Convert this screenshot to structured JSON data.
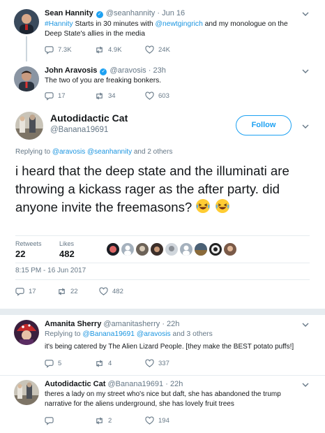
{
  "tweets": {
    "hannity": {
      "name": "Sean Hannity",
      "handle": "@seanhannity",
      "dot": "·",
      "time": "Jun 16",
      "text_parts": [
        "#Hannity",
        " Starts in 30 minutes with ",
        "@newtgingrich",
        " and my monologue on the Deep State's allies in the media"
      ],
      "replies": "7.3K",
      "retweets": "4.9K",
      "likes": "24K"
    },
    "aravosis": {
      "name": "John Aravosis",
      "handle": "@aravosis",
      "dot": "·",
      "time": "23h",
      "text": "The two of you are freaking bonkers.",
      "replies": "17",
      "retweets": "34",
      "likes": "603"
    },
    "main": {
      "name": "Autodidactic Cat",
      "handle": "@Banana19691",
      "follow_label": "Follow",
      "replying_prefix": "Replying to ",
      "replying_user1": "@aravosis",
      "replying_user2": "@seanhannity",
      "replying_suffix": " and 2 others",
      "text": "i heard that the deep state and the illuminati are throwing a kickass rager as the after party. did anyone invite the freemasons?",
      "retweets_label": "Retweets",
      "retweets": "22",
      "likes_label": "Likes",
      "likes": "482",
      "timestamp": "8:15 PM - 16 Jun 2017",
      "replies_count": "17",
      "retweets_count": "22",
      "likes_count": "482"
    },
    "amanita": {
      "name": "Amanita Sherry",
      "handle": "@amanitasherry",
      "dot": "·",
      "time": "22h",
      "replying_prefix": "Replying to ",
      "replying_user1": "@Banana19691",
      "replying_user2": "@aravosis",
      "replying_suffix": " and 3 others",
      "text": "it's being catered by The Alien Lizard People. [they make the BEST potato puffs!]",
      "replies": "5",
      "retweets": "4",
      "likes": "337"
    },
    "cat_reply": {
      "name": "Autodidactic Cat",
      "handle": "@Banana19691",
      "dot": "·",
      "time": "22h",
      "text": "theres a lady on my street who's nice but daft, she has abandoned the trump narrative for the aliens underground, she has lovely fruit trees",
      "replies": "",
      "retweets": "2",
      "likes": "194"
    }
  },
  "colors": {
    "link": "#1b95e0",
    "verified": "#1da1f2",
    "muted": "#657786",
    "divider": "#e6ecf0"
  },
  "icons": [
    "reply-icon",
    "retweet-icon",
    "like-icon",
    "chevron-down-icon",
    "verified-icon",
    "laughing-emoji"
  ]
}
